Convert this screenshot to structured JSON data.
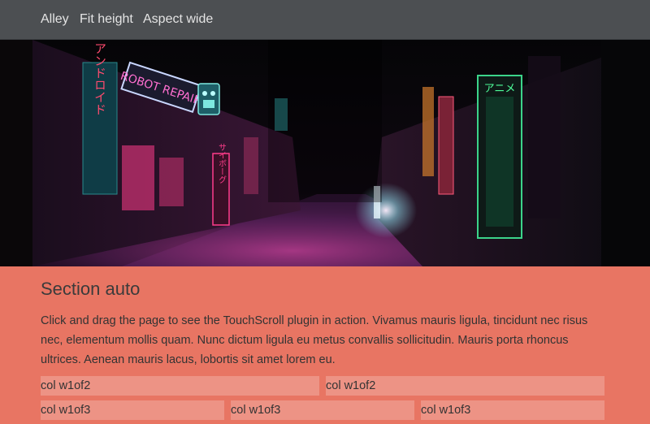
{
  "nav": {
    "items": [
      "Alley",
      "Fit height",
      "Aspect wide"
    ]
  },
  "hero": {
    "sign_robot_repair": "ROBOT REPAIR",
    "sign_left_vertical": "アンドロイド",
    "sign_anime": "アニメ",
    "sign_pink_vertical": "サイボーグ"
  },
  "section": {
    "title": "Section auto",
    "body": "Click and drag the page to see the TouchScroll plugin in action. Vivamus mauris ligula, tincidunt nec risus nec, elementum mollis quam. Nunc dictum ligula eu metus convallis sollicitudin. Mauris porta rhoncus ultrices. Aenean mauris lacus, lobortis sit amet lorem eu.",
    "rows": [
      [
        "col w1of2",
        "col w1of2"
      ],
      [
        "col w1of3",
        "col w1of3",
        "col w1of3"
      ]
    ]
  },
  "colors": {
    "nav_bg": "#4c4f52",
    "section_bg": "#e87563",
    "neon_pink": "#ff3d8b",
    "neon_cyan": "#3fe0d0",
    "neon_green": "#4dff9a"
  }
}
